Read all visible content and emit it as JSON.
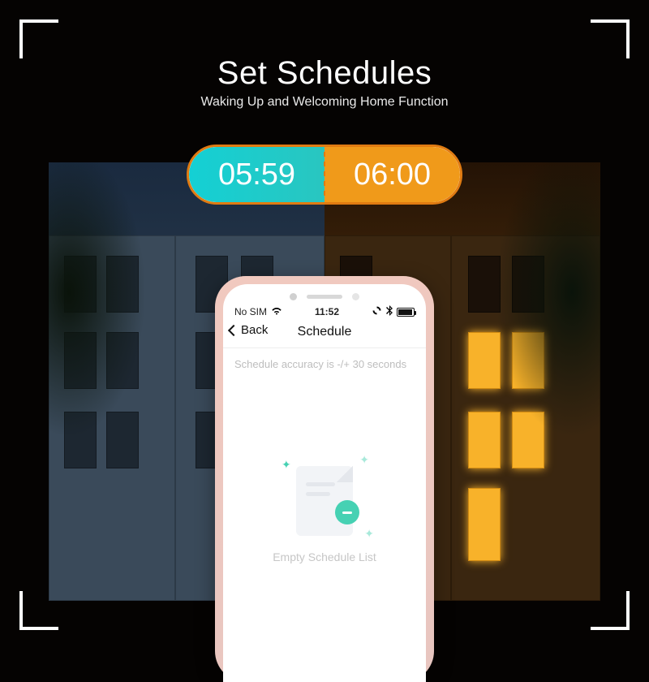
{
  "hero": {
    "title": "Set Schedules",
    "subtitle": "Waking Up and Welcoming Home Function"
  },
  "timepill": {
    "left": "05:59",
    "right": "06:00"
  },
  "phone": {
    "status": {
      "carrier": "No SIM",
      "clock": "11:52"
    },
    "nav": {
      "back_label": "Back",
      "title": "Schedule"
    },
    "hint": "Schedule accuracy is -/+ 30 seconds",
    "empty_label": "Empty Schedule List"
  }
}
